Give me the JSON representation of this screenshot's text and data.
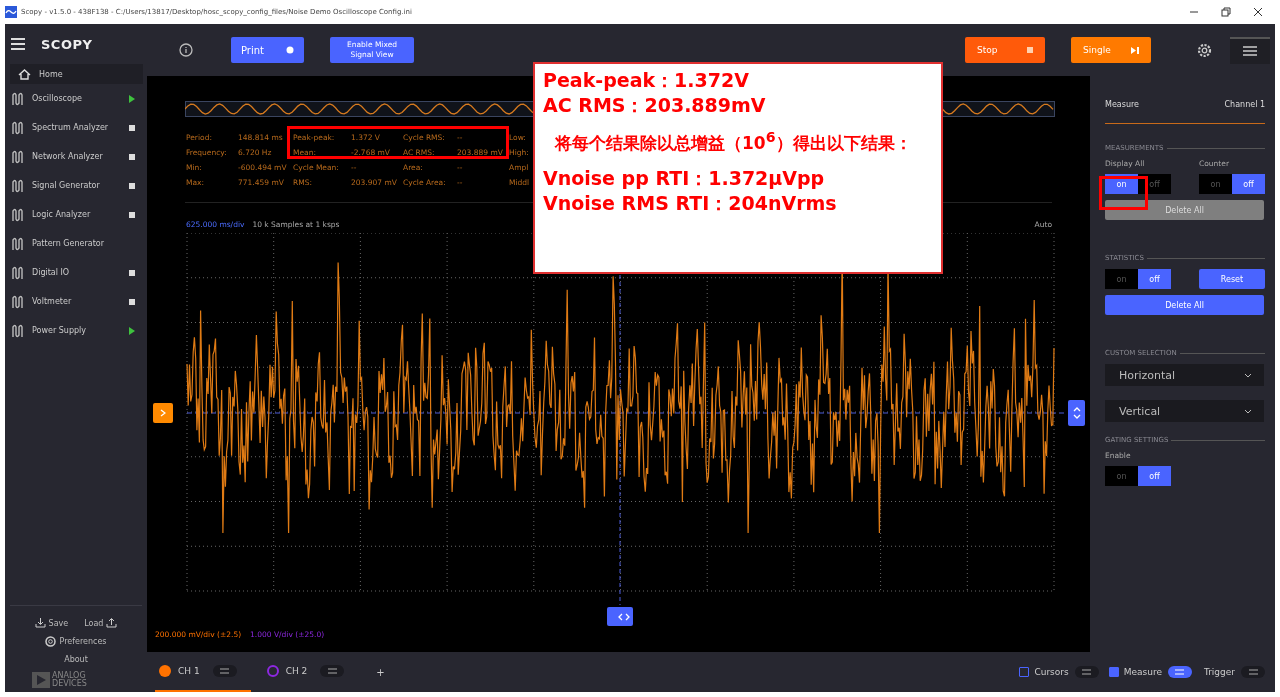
{
  "window": {
    "title": "Scopy - v1.5.0 - 438F138 - C:/Users/13817/Desktop/hosc_scopy_config_files/Noise Demo Oscilloscope Config.ini"
  },
  "sidebar": {
    "logo": "SCOPY",
    "home": "Home",
    "items": [
      {
        "label": "Oscilloscope",
        "kind": "running"
      },
      {
        "label": "Spectrum Analyzer",
        "kind": "stopped"
      },
      {
        "label": "Network Analyzer",
        "kind": "stopped"
      },
      {
        "label": "Signal Generator",
        "kind": "stopped"
      },
      {
        "label": "Logic Analyzer",
        "kind": "stopped"
      },
      {
        "label": "Pattern Generator",
        "kind": "plain"
      },
      {
        "label": "Digital IO",
        "kind": "stopped"
      },
      {
        "label": "Voltmeter",
        "kind": "stopped"
      },
      {
        "label": "Power Supply",
        "kind": "running"
      }
    ],
    "save": "Save",
    "load": "Load",
    "preferences": "Preferences",
    "about": "About",
    "brand": [
      "ANALOG",
      "DEVICES"
    ]
  },
  "toolbar": {
    "print": "Print",
    "mixed_signal": "Enable Mixed Signal View",
    "stop": "Stop",
    "single": "Single"
  },
  "measurements": [
    [
      {
        "label": "Period:",
        "value": "148.814 ms"
      },
      {
        "label": "Peak-peak:",
        "value": "1.372 V"
      },
      {
        "label": "Cycle RMS:",
        "value": "--"
      },
      {
        "label": "Low:"
      }
    ],
    [
      {
        "label": "Frequency:",
        "value": "6.720 Hz"
      },
      {
        "label": "Mean:",
        "value": "-2.768 mV"
      },
      {
        "label": "AC RMS:",
        "value": "203.889 mV"
      },
      {
        "label": "High:"
      }
    ],
    [
      {
        "label": "Min:",
        "value": "-600.494 mV"
      },
      {
        "label": "Cycle Mean:",
        "value": "--"
      },
      {
        "label": "Area:",
        "value": "--"
      },
      {
        "label": "Ampl"
      }
    ],
    [
      {
        "label": "Max:",
        "value": "771.459 mV"
      },
      {
        "label": "RMS:",
        "value": "203.907 mV"
      },
      {
        "label": "Cycle Area:",
        "value": "--"
      },
      {
        "label": "Middl"
      }
    ]
  ],
  "plot": {
    "timebase": "625.000 ms/div",
    "samples": "10 k Samples at 1 ksps",
    "trigger_mode": "Auto",
    "ch1_scale": "200.000 mV/div (±2.5)",
    "ch2_scale": "1.000 V/div (±25.0)"
  },
  "panel": {
    "title": "Measure",
    "channel": "Channel 1",
    "measurements_heading": "MEASUREMENTS",
    "display_all": {
      "label": "Display All",
      "on": true,
      "on_text": "on",
      "off_text": "off"
    },
    "counter": {
      "label": "Counter",
      "on": false,
      "on_text": "on",
      "off_text": "off"
    },
    "delete_all_1": {
      "label": "Delete All",
      "disabled": true
    },
    "statistics_heading": "STATISTICS",
    "statistics": {
      "on": false,
      "on_text": "on",
      "off_text": "off"
    },
    "reset": "Reset",
    "delete_all_2": {
      "label": "Delete All",
      "disabled": false
    },
    "custom_heading": "CUSTOM SELECTION",
    "horizontal": "Horizontal",
    "vertical": "Vertical",
    "gating_heading": "GATING SETTINGS",
    "gating": {
      "label": "Enable",
      "on": false,
      "on_text": "on",
      "off_text": "off"
    }
  },
  "bottom_bar": {
    "channels": [
      {
        "label": "CH 1",
        "selected": true,
        "color": "#ff7200"
      },
      {
        "label": "CH 2",
        "selected": false,
        "color": "#8d28e0"
      }
    ],
    "add": "+",
    "cursors": {
      "label": "Cursors",
      "checked": false
    },
    "measure": {
      "label": "Measure",
      "checked": true
    },
    "trigger": "Trigger"
  },
  "callout": {
    "lines": [
      "Peak-peak：1.372V",
      "AC RMS：203.889mV"
    ],
    "note": "将每个结果除以总增益（10$^{6}$）得出以下结果：",
    "results": [
      "Vnoise pp RTI：1.372μVpp",
      "Vnoise RMS RTI：204nVrms"
    ]
  }
}
